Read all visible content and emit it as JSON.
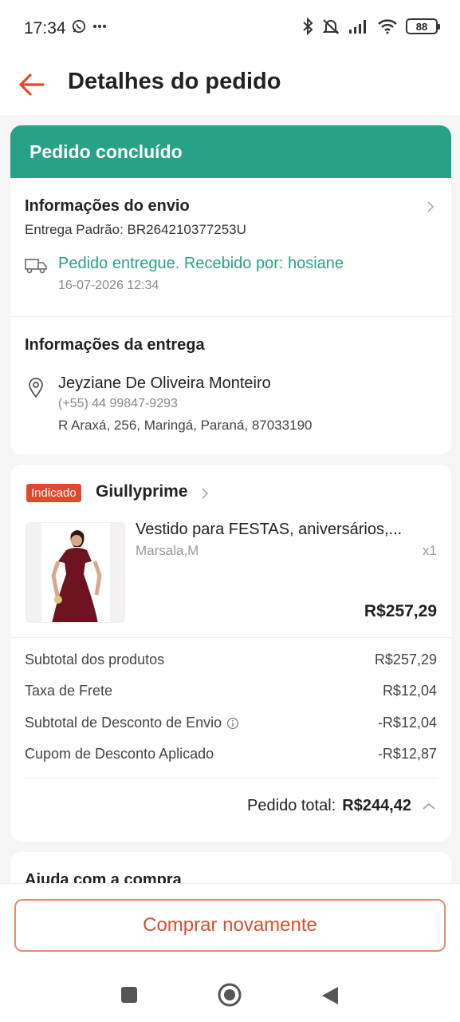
{
  "status_bar": {
    "time": "17:34",
    "battery": "88",
    "icons": [
      "whatsapp-icon",
      "more-icon",
      "bluetooth-icon",
      "mute-icon",
      "signal-icon",
      "wifi-icon",
      "battery-icon"
    ]
  },
  "header": {
    "title": "Detalhes do pedido",
    "back_icon": "back-arrow-icon"
  },
  "order_status": {
    "label": "Pedido concluído",
    "color": "#26a286"
  },
  "shipping": {
    "title": "Informações do envio",
    "method": "Entrega Padrão: BR264210377253U",
    "status": "Pedido entregue. Recebido por: hosiane",
    "date": "16-07-2026 12:34"
  },
  "delivery": {
    "title": "Informações da entrega",
    "name": "Jeyziane De Oliveira Monteiro",
    "phone": "(+55) 44 99847-9293",
    "address": "R Araxá, 256, Maringá, Paraná, 87033190"
  },
  "shop": {
    "badge": "Indicado",
    "name": "Giullyprime"
  },
  "product": {
    "title": "Vestido para FESTAS, aniversários,...",
    "variant": "Marsala,M",
    "quantity": "x1",
    "price": "R$257,29"
  },
  "summary": {
    "rows": [
      {
        "label": "Subtotal dos produtos",
        "value": "R$257,29"
      },
      {
        "label": "Taxa de Frete",
        "value": "R$12,04"
      },
      {
        "label": "Subtotal de Desconto de Envio",
        "value": "-R$12,04"
      },
      {
        "label": "Cupom de Desconto Aplicado",
        "value": "-R$12,87"
      }
    ],
    "total_label": "Pedido total:",
    "total_value": "R$244,42"
  },
  "help": {
    "title": "Ajuda com a compra"
  },
  "actions": {
    "buy_again": "Comprar novamente"
  },
  "colors": {
    "accent": "#d7502e",
    "success": "#26a286"
  }
}
